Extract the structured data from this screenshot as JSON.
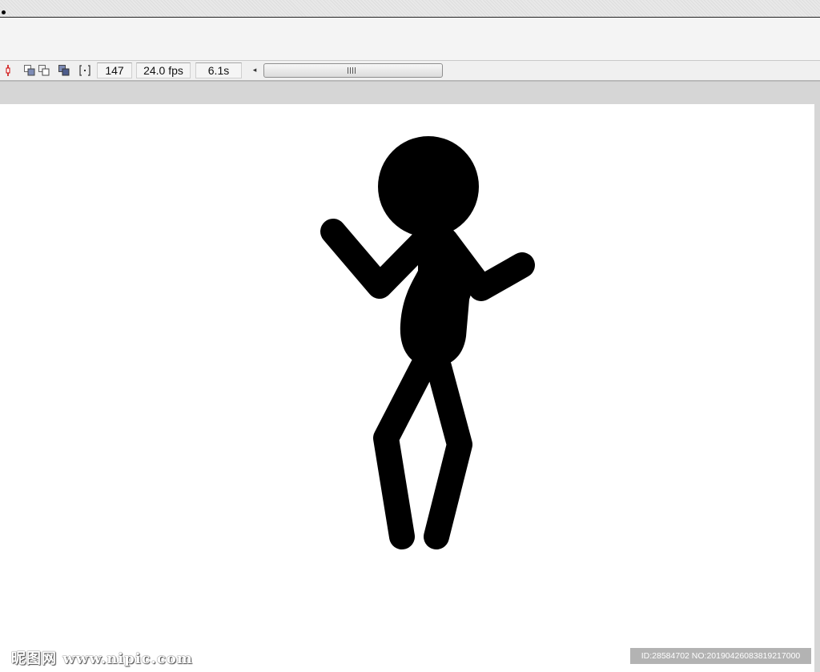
{
  "toolbar": {
    "frame_number": "147",
    "frame_rate": "24.0 fps",
    "elapsed_time": "6.1s",
    "icons": [
      "playhead-marker-icon",
      "center-frame-icon",
      "onion-skin-icon",
      "onion-skin-outlines-icon",
      "edit-multiple-frames-icon",
      "modify-onion-markers-icon"
    ],
    "scroll_left_glyph": "◂"
  },
  "stage": {
    "background": "#ffffff",
    "figure_color": "#000000"
  },
  "watermark": {
    "logo_text": "昵图网 www.nipic.com",
    "id_text": "ID:28584702 NO:20190426083819217000"
  }
}
